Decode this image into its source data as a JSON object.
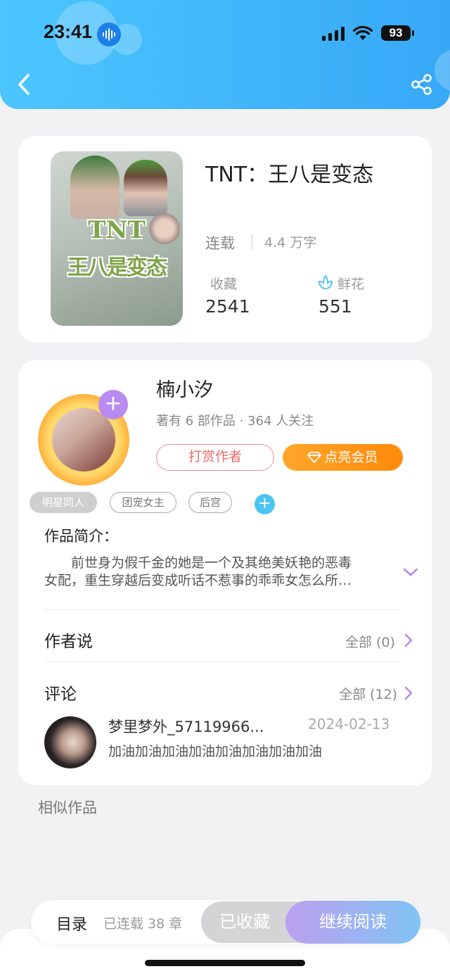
{
  "status_bar": {
    "time": "23:41",
    "battery": "93",
    "icons": [
      "voice-memo-icon",
      "cellular-signal-icon",
      "wifi-icon",
      "battery-icon"
    ]
  },
  "header": {
    "back_icon": "chevron-left-icon",
    "share_icon": "share-icon"
  },
  "book": {
    "title": "TNT：王八是变态",
    "cover_text_top": "TNT",
    "cover_text_main": "王八是变态",
    "status": "连载",
    "word_count": "4.4 万字",
    "favorites_label": "收藏",
    "favorites_value": "2541",
    "flowers_label": "鲜花",
    "flowers_value": "551"
  },
  "author": {
    "name": "楠小汐",
    "meta": "著有 6 部作品 · 364 人关注",
    "tip_label": "打赏作者",
    "vip_label": "点亮会员"
  },
  "tags": [
    "明星同人",
    "团宠女主",
    "后宫"
  ],
  "intro": {
    "title": "作品简介：",
    "line1": "前世身为假千金的她是一个及其绝美妖艳的恶毒",
    "line2": "女配，重生穿越后变成听话不惹事的乖乖女怎么所…"
  },
  "author_says": {
    "title": "作者说",
    "link": "全部 (0)"
  },
  "comments": {
    "title": "评论",
    "link": "全部 (12)",
    "items": [
      {
        "user": "梦里梦外_57119966...",
        "date": "2024-02-13",
        "text": "加油加油加油加油加油加油加油加油"
      }
    ]
  },
  "similar_title": "相似作品",
  "bottom_bar": {
    "toc_label": "目录",
    "chapters_label": "已连载 38 章",
    "favorited_label": "已收藏",
    "continue_label": "继续阅读"
  },
  "colors": {
    "header_accent": "#37a8f6",
    "vip_orange": "#ff8a0a",
    "tip_red": "#ef6a6a",
    "purple_accent": "#b78bf0",
    "tag_add_blue": "#4cc4f2"
  }
}
